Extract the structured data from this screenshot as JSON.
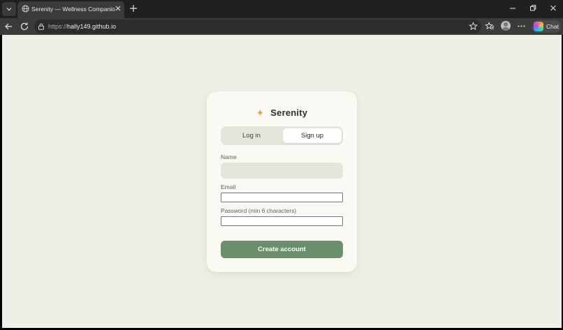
{
  "browser": {
    "tab_title": "Serenity — Wellness Companion",
    "address_scheme": "https://",
    "address_host": "hally149.github.io",
    "chat_label": "Chat",
    "icons": [
      "tab-list-icon",
      "globe-icon",
      "close-icon",
      "plus-icon",
      "minimize-icon",
      "restore-icon",
      "window-close-icon",
      "back-arrow-icon",
      "refresh-icon",
      "site-info-icon",
      "star-icon",
      "favorites-icon",
      "profile-icon",
      "more-icon",
      "copilot-icon"
    ]
  },
  "card": {
    "brand_name": "Serenity",
    "brand_icon": "sparkle-icon",
    "tabs": [
      {
        "label": "Log in",
        "active": false
      },
      {
        "label": "Sign up",
        "active": true
      }
    ],
    "fields": {
      "name_label": "Name",
      "name_value": "",
      "email_label": "Email",
      "email_value": "",
      "password_label": "Password (min 6 characters)",
      "password_value": ""
    },
    "submit_label": "Create account"
  },
  "colors": {
    "page_bg": "#eef0e7",
    "card_bg": "#fbf9f3",
    "accent": "#6b8f6b",
    "sparkle": "#d9a34a",
    "segment_bg": "#e3e6da"
  }
}
